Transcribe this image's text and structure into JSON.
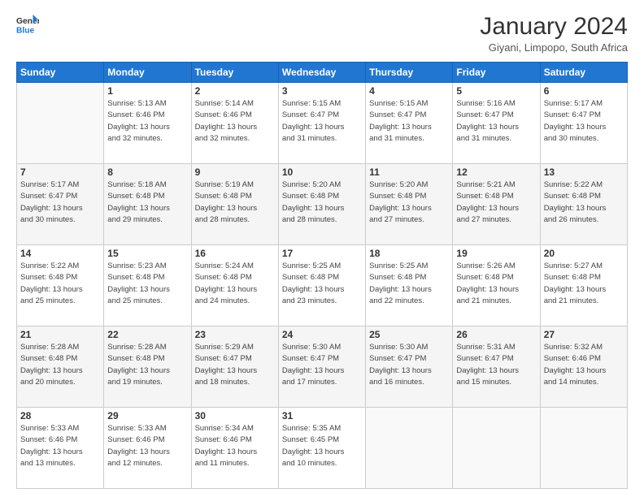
{
  "header": {
    "logo_line1": "General",
    "logo_line2": "Blue",
    "title": "January 2024",
    "subtitle": "Giyani, Limpopo, South Africa"
  },
  "days_of_week": [
    "Sunday",
    "Monday",
    "Tuesday",
    "Wednesday",
    "Thursday",
    "Friday",
    "Saturday"
  ],
  "weeks": [
    {
      "shaded": false,
      "days": [
        {
          "num": "",
          "info": ""
        },
        {
          "num": "1",
          "info": "Sunrise: 5:13 AM\nSunset: 6:46 PM\nDaylight: 13 hours\nand 32 minutes."
        },
        {
          "num": "2",
          "info": "Sunrise: 5:14 AM\nSunset: 6:46 PM\nDaylight: 13 hours\nand 32 minutes."
        },
        {
          "num": "3",
          "info": "Sunrise: 5:15 AM\nSunset: 6:47 PM\nDaylight: 13 hours\nand 31 minutes."
        },
        {
          "num": "4",
          "info": "Sunrise: 5:15 AM\nSunset: 6:47 PM\nDaylight: 13 hours\nand 31 minutes."
        },
        {
          "num": "5",
          "info": "Sunrise: 5:16 AM\nSunset: 6:47 PM\nDaylight: 13 hours\nand 31 minutes."
        },
        {
          "num": "6",
          "info": "Sunrise: 5:17 AM\nSunset: 6:47 PM\nDaylight: 13 hours\nand 30 minutes."
        }
      ]
    },
    {
      "shaded": true,
      "days": [
        {
          "num": "7",
          "info": "Sunrise: 5:17 AM\nSunset: 6:47 PM\nDaylight: 13 hours\nand 30 minutes."
        },
        {
          "num": "8",
          "info": "Sunrise: 5:18 AM\nSunset: 6:48 PM\nDaylight: 13 hours\nand 29 minutes."
        },
        {
          "num": "9",
          "info": "Sunrise: 5:19 AM\nSunset: 6:48 PM\nDaylight: 13 hours\nand 28 minutes."
        },
        {
          "num": "10",
          "info": "Sunrise: 5:20 AM\nSunset: 6:48 PM\nDaylight: 13 hours\nand 28 minutes."
        },
        {
          "num": "11",
          "info": "Sunrise: 5:20 AM\nSunset: 6:48 PM\nDaylight: 13 hours\nand 27 minutes."
        },
        {
          "num": "12",
          "info": "Sunrise: 5:21 AM\nSunset: 6:48 PM\nDaylight: 13 hours\nand 27 minutes."
        },
        {
          "num": "13",
          "info": "Sunrise: 5:22 AM\nSunset: 6:48 PM\nDaylight: 13 hours\nand 26 minutes."
        }
      ]
    },
    {
      "shaded": false,
      "days": [
        {
          "num": "14",
          "info": "Sunrise: 5:22 AM\nSunset: 6:48 PM\nDaylight: 13 hours\nand 25 minutes."
        },
        {
          "num": "15",
          "info": "Sunrise: 5:23 AM\nSunset: 6:48 PM\nDaylight: 13 hours\nand 25 minutes."
        },
        {
          "num": "16",
          "info": "Sunrise: 5:24 AM\nSunset: 6:48 PM\nDaylight: 13 hours\nand 24 minutes."
        },
        {
          "num": "17",
          "info": "Sunrise: 5:25 AM\nSunset: 6:48 PM\nDaylight: 13 hours\nand 23 minutes."
        },
        {
          "num": "18",
          "info": "Sunrise: 5:25 AM\nSunset: 6:48 PM\nDaylight: 13 hours\nand 22 minutes."
        },
        {
          "num": "19",
          "info": "Sunrise: 5:26 AM\nSunset: 6:48 PM\nDaylight: 13 hours\nand 21 minutes."
        },
        {
          "num": "20",
          "info": "Sunrise: 5:27 AM\nSunset: 6:48 PM\nDaylight: 13 hours\nand 21 minutes."
        }
      ]
    },
    {
      "shaded": true,
      "days": [
        {
          "num": "21",
          "info": "Sunrise: 5:28 AM\nSunset: 6:48 PM\nDaylight: 13 hours\nand 20 minutes."
        },
        {
          "num": "22",
          "info": "Sunrise: 5:28 AM\nSunset: 6:48 PM\nDaylight: 13 hours\nand 19 minutes."
        },
        {
          "num": "23",
          "info": "Sunrise: 5:29 AM\nSunset: 6:47 PM\nDaylight: 13 hours\nand 18 minutes."
        },
        {
          "num": "24",
          "info": "Sunrise: 5:30 AM\nSunset: 6:47 PM\nDaylight: 13 hours\nand 17 minutes."
        },
        {
          "num": "25",
          "info": "Sunrise: 5:30 AM\nSunset: 6:47 PM\nDaylight: 13 hours\nand 16 minutes."
        },
        {
          "num": "26",
          "info": "Sunrise: 5:31 AM\nSunset: 6:47 PM\nDaylight: 13 hours\nand 15 minutes."
        },
        {
          "num": "27",
          "info": "Sunrise: 5:32 AM\nSunset: 6:46 PM\nDaylight: 13 hours\nand 14 minutes."
        }
      ]
    },
    {
      "shaded": false,
      "days": [
        {
          "num": "28",
          "info": "Sunrise: 5:33 AM\nSunset: 6:46 PM\nDaylight: 13 hours\nand 13 minutes."
        },
        {
          "num": "29",
          "info": "Sunrise: 5:33 AM\nSunset: 6:46 PM\nDaylight: 13 hours\nand 12 minutes."
        },
        {
          "num": "30",
          "info": "Sunrise: 5:34 AM\nSunset: 6:46 PM\nDaylight: 13 hours\nand 11 minutes."
        },
        {
          "num": "31",
          "info": "Sunrise: 5:35 AM\nSunset: 6:45 PM\nDaylight: 13 hours\nand 10 minutes."
        },
        {
          "num": "",
          "info": ""
        },
        {
          "num": "",
          "info": ""
        },
        {
          "num": "",
          "info": ""
        }
      ]
    }
  ]
}
